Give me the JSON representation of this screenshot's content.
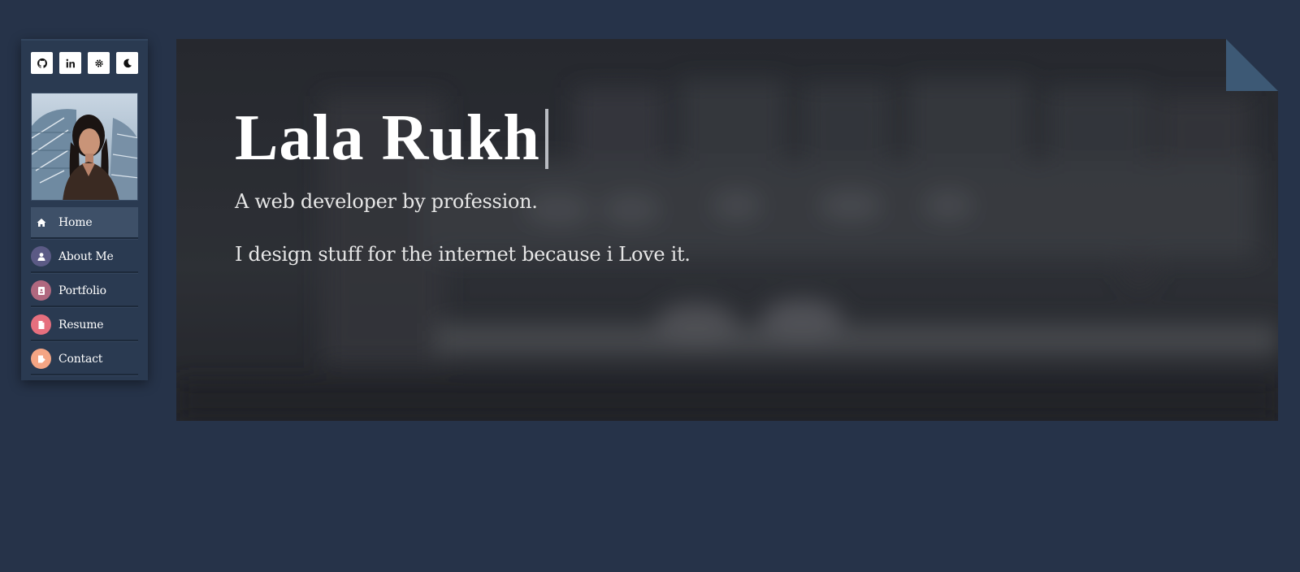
{
  "sidebar": {
    "social": [
      {
        "icon": "github-icon",
        "label": "GitHub"
      },
      {
        "icon": "linkedin-icon",
        "label": "in"
      },
      {
        "icon": "settings-icon",
        "label": "Settings"
      },
      {
        "icon": "moon-icon",
        "label": "Dark mode"
      }
    ],
    "nav": [
      {
        "label": "Home",
        "icon": "home-icon",
        "color": "#3e5068",
        "active": true
      },
      {
        "label": "About Me",
        "icon": "user-icon",
        "color": "#5b5a85",
        "active": false
      },
      {
        "label": "Portfolio",
        "icon": "portfolio-icon",
        "color": "#b0687f",
        "active": false
      },
      {
        "label": "Resume",
        "icon": "document-icon",
        "color": "#e66f7e",
        "active": false
      },
      {
        "label": "Contact",
        "icon": "contact-icon",
        "color": "#f4a584",
        "active": false
      }
    ]
  },
  "hero": {
    "title": "Lala Rukh",
    "subtitle": "A web developer by profession.",
    "tagline": "I design stuff for the internet because i Love it."
  },
  "colors": {
    "page_background": "#263349",
    "sidebar_background": "#2a3a51",
    "active_item": "#3e5068",
    "fold_accent": "#3d5975"
  }
}
